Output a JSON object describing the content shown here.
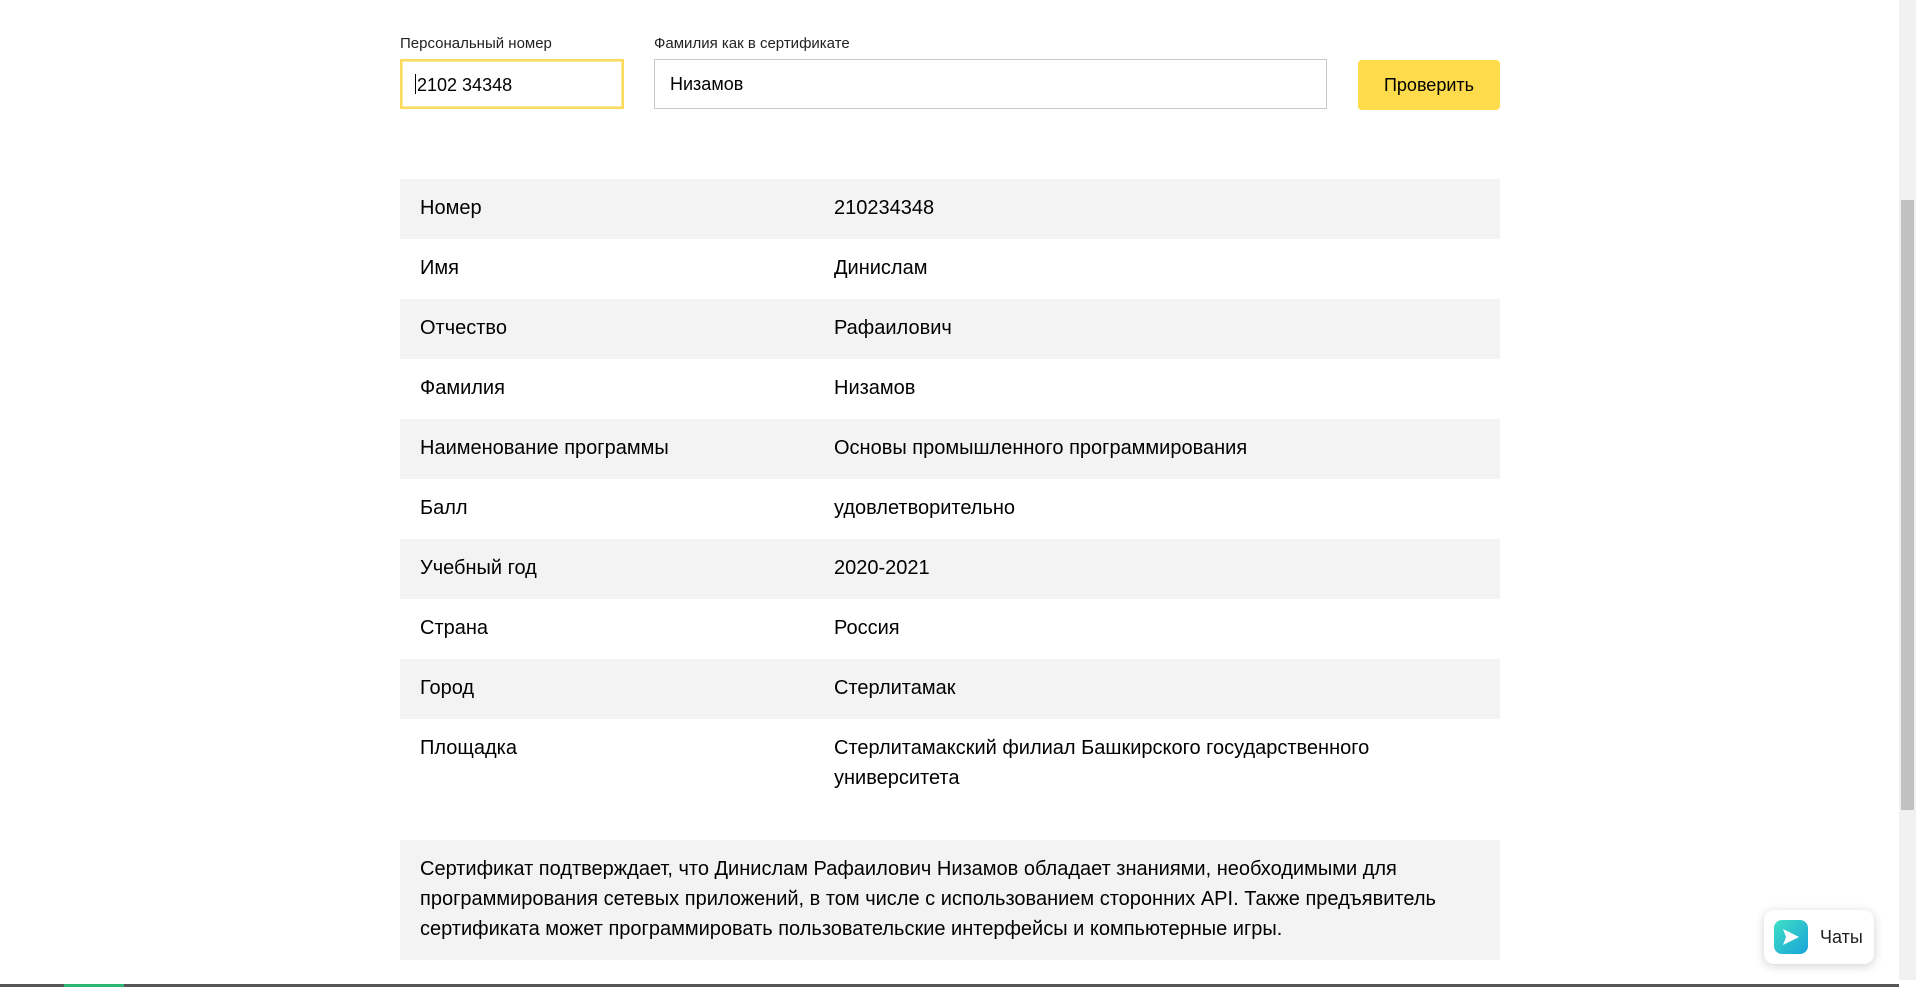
{
  "form": {
    "number_label": "Персональный номер",
    "number_value": "2102 34348",
    "surname_label": "Фамилия как в сертификате",
    "surname_value": "Низамов",
    "check_button": "Проверить"
  },
  "rows": [
    {
      "key": "Номер",
      "value": "210234348"
    },
    {
      "key": "Имя",
      "value": "Динислам"
    },
    {
      "key": "Отчество",
      "value": "Рафаилович"
    },
    {
      "key": "Фамилия",
      "value": "Низамов"
    },
    {
      "key": "Наименование программы",
      "value": "Основы промышленного программирования"
    },
    {
      "key": "Балл",
      "value": "удовлетворительно"
    },
    {
      "key": "Учебный год",
      "value": "2020-2021"
    },
    {
      "key": "Страна",
      "value": "Россия"
    },
    {
      "key": "Город",
      "value": "Стерлитамак"
    },
    {
      "key": "Площадка",
      "value": "Стерлитамакский филиал Башкирского государственного университета"
    }
  ],
  "description": "Сертификат подтверждает, что Динислам Рафаилович Низамов обладает знаниями, необходимыми для программирования сетевых приложений, в том числе с использованием сторонних API. Также предъявитель сертификата может программировать пользовательские интерфейсы и компьютерные игры.",
  "chat": {
    "label": "Чаты",
    "icon": "send-icon"
  },
  "colors": {
    "accent": "#fddb4a",
    "row_shade": "#f3f3f3"
  }
}
